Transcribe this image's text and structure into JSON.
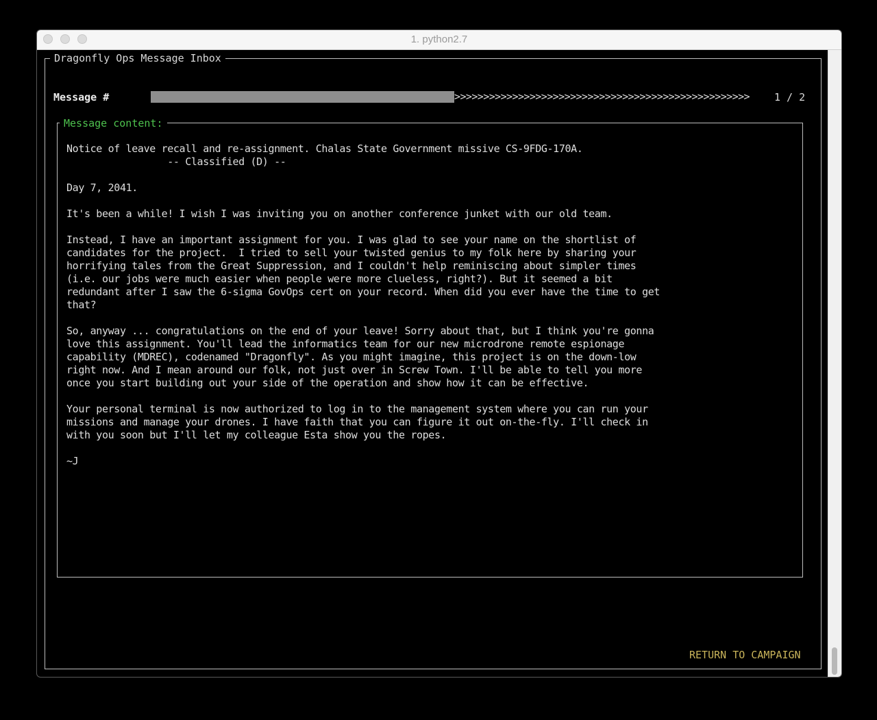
{
  "window": {
    "title": "1. python2.7"
  },
  "inbox": {
    "title": "Dragonfly Ops Message Inbox",
    "message_label": "Message #",
    "progress_arrows": ">>>>>>>>>>>>>>>>>>>>>>>>>>>>>>>>>>>>>>>>>>>>>>>>>>>",
    "progress_fraction": 0.5,
    "page_indicator": "1 / 2",
    "content_title": "Message content:",
    "message_body": "Notice of leave recall and re-assignment. Chalas State Government missive CS-9FDG-170A.\n                 -- Classified (D) --\n\nDay 7, 2041.\n\nIt's been a while! I wish I was inviting you on another conference junket with our old team.\n\nInstead, I have an important assignment for you. I was glad to see your name on the shortlist of\ncandidates for the project.  I tried to sell your twisted genius to my folk here by sharing your\nhorrifying tales from the Great Suppression, and I couldn't help reminiscing about simpler times\n(i.e. our jobs were much easier when people were more clueless, right?). But it seemed a bit\nredundant after I saw the 6-sigma GovOps cert on your record. When did you ever have the time to get\nthat?\n\nSo, anyway ... congratulations on the end of your leave! Sorry about that, but I think you're gonna\nlove this assignment. You'll lead the informatics team for our new microdrone remote espionage\ncapability (MDREC), codenamed \"Dragonfly\". As you might imagine, this project is on the down-low\nright now. And I mean around our folk, not just over in Screw Town. I'll be able to tell you more\nonce you start building out your side of the operation and show how it can be effective.\n\nYour personal terminal is now authorized to log in to the management system where you can run your\nmissions and manage your drones. I have faith that you can figure it out on-the-fly. I'll check in\nwith you soon but I'll let my colleague Esta show you the ropes.\n\n~J",
    "return_button": "RETURN TO CAMPAIGN"
  },
  "colors": {
    "background": "#000000",
    "text": "#d9d9d9",
    "accent_green": "#4ec24e",
    "return_yellow": "#c9b45a",
    "progress_fill": "#8e8e8e"
  }
}
